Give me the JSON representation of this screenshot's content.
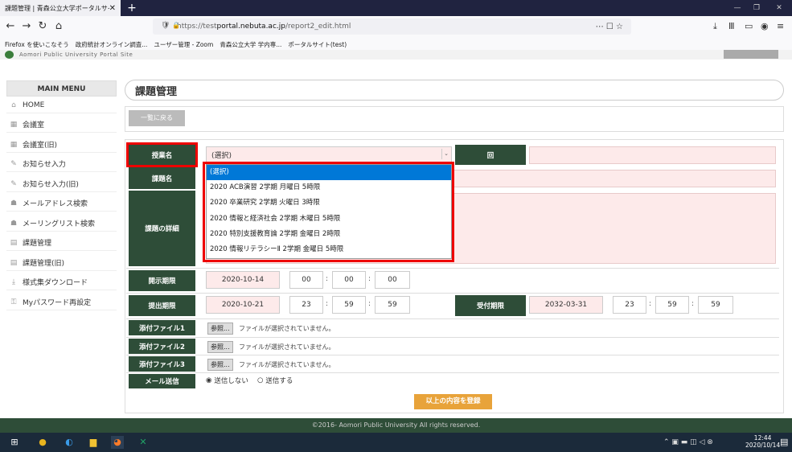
{
  "browser": {
    "tab_title": "課題管理 | 青森公立大学ポータルサイ",
    "tab_close": "✕",
    "url_prefix": "https://test",
    "url_host": "portal.nebuta.ac.jp",
    "url_path": "/report2_edit.html",
    "url_tools": "⋯ ☐ ☆",
    "bookmarks": [
      "Firefox を使いこなそう",
      "政府統計オンライン調査...",
      "ユーザー管理 - Zoom",
      "青森公立大学 学内専...",
      "ポータルサイト(test)"
    ]
  },
  "site": {
    "strip": "Aomori Public University Portal Site"
  },
  "sidebar": {
    "header": "MAIN MENU",
    "items": [
      {
        "label": "HOME",
        "icon": "home-icon"
      },
      {
        "label": "会議室",
        "icon": "meeting-icon"
      },
      {
        "label": "会議室(旧)",
        "icon": "meeting-icon"
      },
      {
        "label": "お知らせ入力",
        "icon": "edit-icon"
      },
      {
        "label": "お知らせ入力(旧)",
        "icon": "edit-icon"
      },
      {
        "label": "メールアドレス検索",
        "icon": "search-people-icon"
      },
      {
        "label": "メーリングリスト検索",
        "icon": "search-people-icon"
      },
      {
        "label": "課題管理",
        "icon": "task-icon"
      },
      {
        "label": "課題管理(旧)",
        "icon": "task-icon"
      },
      {
        "label": "様式集ダウンロード",
        "icon": "download-icon"
      },
      {
        "label": "Myパスワード再設定",
        "icon": "user-key-icon"
      }
    ]
  },
  "page": {
    "title": "課題管理",
    "back_button": "一覧に戻る",
    "form": {
      "course_label": "授業名",
      "course_selected": "(選択)",
      "round_label": "回",
      "assignment_label": "課題名",
      "details_label": "課題の詳細",
      "open_label": "開示期限",
      "open_date": "2020-10-14",
      "open_hour": "00",
      "open_min": "00",
      "open_sec": "00",
      "due_label": "提出期限",
      "due_date": "2020-10-21",
      "due_hour": "23",
      "due_min": "59",
      "due_sec": "59",
      "accept_label": "受付期限",
      "accept_date": "2032-03-31",
      "accept_hour": "23",
      "accept_min": "59",
      "accept_sec": "59",
      "colon": ":",
      "attach1_label": "添付ファイル1",
      "attach2_label": "添付ファイル2",
      "attach3_label": "添付ファイル3",
      "browse": "参照...",
      "no_file": "ファイルが選択されていません。",
      "mail_label": "メール送信",
      "mail_no": "送信しない",
      "mail_yes": "送信する",
      "submit": "以上の内容を登録"
    },
    "dropdown_options": [
      "(選択)",
      "2020 ACB演習 2学期 月曜日 5時限",
      "2020 卒業研究 2学期 火曜日 3時限",
      "2020 情報と経済社会 2学期 木曜日 5時限",
      "2020 特別支援教育論 2学期 金曜日 2時限",
      "2020 情報リテラシーⅡ 2学期 金曜日 5時限"
    ]
  },
  "footer": "©2016- Aomori Public University All rights reserved.",
  "taskbar": {
    "time": "12:44",
    "date": "2020/10/14"
  },
  "colors": {
    "label_bg": "#2e4d38",
    "highlight_red": "#e00000",
    "submit": "#e8a33a",
    "selected_option": "#0078d7"
  }
}
